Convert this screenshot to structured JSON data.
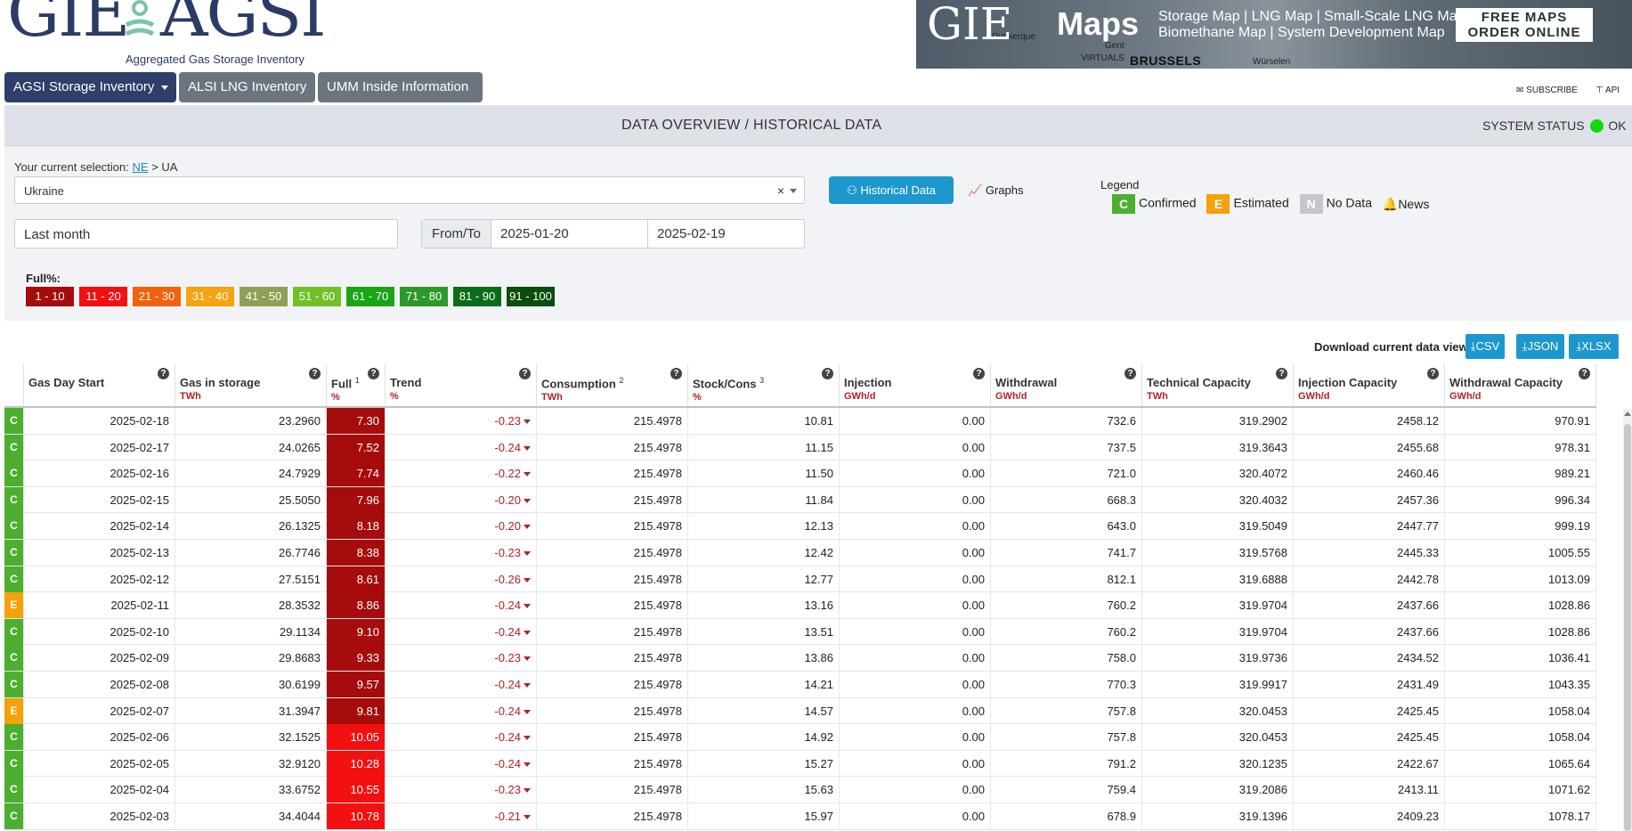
{
  "header": {
    "logo_gie": "GIE",
    "logo_agsi": "AGSI",
    "logo_subtitle": "Aggregated Gas Storage Inventory",
    "banner": {
      "brand": "GIE",
      "maps": "Maps",
      "line1": "Storage Map | LNG Map | Small-Scale LNG Map",
      "line2": "Biomethane Map | System Development Map",
      "cta_line1": "FREE MAPS",
      "cta_line2": "ORDER ONLINE",
      "city": "BRUSSELS",
      "place1": "VIRTUALS",
      "place2": "Dunkerque",
      "place3": "Gent",
      "place4": "Würselen"
    },
    "nav": {
      "primary": "AGSI Storage Inventory",
      "second": "ALSI LNG Inventory",
      "third": "UMM Inside Information"
    },
    "subscribe": "SUBSCRIBE",
    "api": "API"
  },
  "panel": {
    "title": "DATA OVERVIEW / HISTORICAL DATA",
    "system_status_label": "SYSTEM STATUS",
    "system_status_value": "OK",
    "status_color": "#12d80f",
    "selection_prefix": "Your current selection:",
    "selection_link": "NE",
    "selection_rest": "> UA",
    "country": "Ukraine",
    "clear_glyph": "×",
    "historical_button": "Historical Data",
    "graphs_button": "Graphs",
    "legend_title": "Legend",
    "legend": [
      {
        "badge": "C",
        "label": "Confirmed",
        "color": "#4caf30"
      },
      {
        "badge": "E",
        "label": "Estimated",
        "color": "#f5a10a"
      },
      {
        "badge": "N",
        "label": "No Data",
        "color": "#c3c6ca"
      }
    ],
    "news": "News",
    "period": "Last month",
    "from_to_label": "From/To",
    "from_date": "2025-01-20",
    "to_date": "2025-02-19",
    "full_label": "Full%:",
    "scale": [
      {
        "label": "1 - 10",
        "color": "#a60c0c"
      },
      {
        "label": "11 - 20",
        "color": "#f21010"
      },
      {
        "label": "21 - 30",
        "color": "#f2620e"
      },
      {
        "label": "31 - 40",
        "color": "#f5a30f"
      },
      {
        "label": "41 - 50",
        "color": "#8ea055"
      },
      {
        "label": "51 - 60",
        "color": "#71c124"
      },
      {
        "label": "61 - 70",
        "color": "#1aa516"
      },
      {
        "label": "71 - 80",
        "color": "#2c9a2a"
      },
      {
        "label": "81 - 90",
        "color": "#0c6d18"
      },
      {
        "label": "91 - 100",
        "color": "#0a4d0c"
      }
    ]
  },
  "downloads": {
    "label": "Download current data view:",
    "csv": "CSV",
    "json": "JSON",
    "xlsx": "XLSX"
  },
  "table": {
    "columns": [
      {
        "name": "Gas Day Start",
        "sup": "",
        "unit": ""
      },
      {
        "name": "Gas in storage",
        "sup": "",
        "unit": "TWh"
      },
      {
        "name": "Full",
        "sup": "1",
        "unit": "%"
      },
      {
        "name": "Trend",
        "sup": "",
        "unit": "%"
      },
      {
        "name": "Consumption",
        "sup": "2",
        "unit": "TWh"
      },
      {
        "name": "Stock/Cons",
        "sup": "3",
        "unit": "%"
      },
      {
        "name": "Injection",
        "sup": "",
        "unit": "GWh/d"
      },
      {
        "name": "Withdrawal",
        "sup": "",
        "unit": "GWh/d"
      },
      {
        "name": "Technical Capacity",
        "sup": "",
        "unit": "TWh"
      },
      {
        "name": "Injection Capacity",
        "sup": "",
        "unit": "GWh/d"
      },
      {
        "name": "Withdrawal Capacity",
        "sup": "",
        "unit": "GWh/d"
      }
    ],
    "rows": [
      {
        "status": "C",
        "date": "2025-02-18",
        "gas": "23.2960",
        "full": "7.30",
        "trend": "-0.23",
        "cons": "215.4978",
        "stock": "10.81",
        "inj": "0.00",
        "wd": "732.6",
        "tech": "319.2902",
        "injcap": "2458.12",
        "wdcap": "970.91"
      },
      {
        "status": "C",
        "date": "2025-02-17",
        "gas": "24.0265",
        "full": "7.52",
        "trend": "-0.24",
        "cons": "215.4978",
        "stock": "11.15",
        "inj": "0.00",
        "wd": "737.5",
        "tech": "319.3643",
        "injcap": "2455.68",
        "wdcap": "978.31"
      },
      {
        "status": "C",
        "date": "2025-02-16",
        "gas": "24.7929",
        "full": "7.74",
        "trend": "-0.22",
        "cons": "215.4978",
        "stock": "11.50",
        "inj": "0.00",
        "wd": "721.0",
        "tech": "320.4072",
        "injcap": "2460.46",
        "wdcap": "989.21"
      },
      {
        "status": "C",
        "date": "2025-02-15",
        "gas": "25.5050",
        "full": "7.96",
        "trend": "-0.20",
        "cons": "215.4978",
        "stock": "11.84",
        "inj": "0.00",
        "wd": "668.3",
        "tech": "320.4032",
        "injcap": "2457.36",
        "wdcap": "996.34"
      },
      {
        "status": "C",
        "date": "2025-02-14",
        "gas": "26.1325",
        "full": "8.18",
        "trend": "-0.20",
        "cons": "215.4978",
        "stock": "12.13",
        "inj": "0.00",
        "wd": "643.0",
        "tech": "319.5049",
        "injcap": "2447.77",
        "wdcap": "999.19"
      },
      {
        "status": "C",
        "date": "2025-02-13",
        "gas": "26.7746",
        "full": "8.38",
        "trend": "-0.23",
        "cons": "215.4978",
        "stock": "12.42",
        "inj": "0.00",
        "wd": "741.7",
        "tech": "319.5768",
        "injcap": "2445.33",
        "wdcap": "1005.55"
      },
      {
        "status": "C",
        "date": "2025-02-12",
        "gas": "27.5151",
        "full": "8.61",
        "trend": "-0.26",
        "cons": "215.4978",
        "stock": "12.77",
        "inj": "0.00",
        "wd": "812.1",
        "tech": "319.6888",
        "injcap": "2442.78",
        "wdcap": "1013.09"
      },
      {
        "status": "E",
        "date": "2025-02-11",
        "gas": "28.3532",
        "full": "8.86",
        "trend": "-0.24",
        "cons": "215.4978",
        "stock": "13.16",
        "inj": "0.00",
        "wd": "760.2",
        "tech": "319.9704",
        "injcap": "2437.66",
        "wdcap": "1028.86"
      },
      {
        "status": "C",
        "date": "2025-02-10",
        "gas": "29.1134",
        "full": "9.10",
        "trend": "-0.24",
        "cons": "215.4978",
        "stock": "13.51",
        "inj": "0.00",
        "wd": "760.2",
        "tech": "319.9704",
        "injcap": "2437.66",
        "wdcap": "1028.86"
      },
      {
        "status": "C",
        "date": "2025-02-09",
        "gas": "29.8683",
        "full": "9.33",
        "trend": "-0.23",
        "cons": "215.4978",
        "stock": "13.86",
        "inj": "0.00",
        "wd": "758.0",
        "tech": "319.9736",
        "injcap": "2434.52",
        "wdcap": "1036.41"
      },
      {
        "status": "C",
        "date": "2025-02-08",
        "gas": "30.6199",
        "full": "9.57",
        "trend": "-0.24",
        "cons": "215.4978",
        "stock": "14.21",
        "inj": "0.00",
        "wd": "770.3",
        "tech": "319.9917",
        "injcap": "2431.49",
        "wdcap": "1043.35"
      },
      {
        "status": "E",
        "date": "2025-02-07",
        "gas": "31.3947",
        "full": "9.81",
        "trend": "-0.24",
        "cons": "215.4978",
        "stock": "14.57",
        "inj": "0.00",
        "wd": "757.8",
        "tech": "320.0453",
        "injcap": "2425.45",
        "wdcap": "1058.04"
      },
      {
        "status": "C",
        "date": "2025-02-06",
        "gas": "32.1525",
        "full": "10.05",
        "trend": "-0.24",
        "cons": "215.4978",
        "stock": "14.92",
        "inj": "0.00",
        "wd": "757.8",
        "tech": "320.0453",
        "injcap": "2425.45",
        "wdcap": "1058.04"
      },
      {
        "status": "C",
        "date": "2025-02-05",
        "gas": "32.9120",
        "full": "10.28",
        "trend": "-0.24",
        "cons": "215.4978",
        "stock": "15.27",
        "inj": "0.00",
        "wd": "791.2",
        "tech": "320.1235",
        "injcap": "2422.67",
        "wdcap": "1065.64"
      },
      {
        "status": "C",
        "date": "2025-02-04",
        "gas": "33.6752",
        "full": "10.55",
        "trend": "-0.23",
        "cons": "215.4978",
        "stock": "15.63",
        "inj": "0.00",
        "wd": "759.4",
        "tech": "319.2086",
        "injcap": "2413.11",
        "wdcap": "1071.62"
      },
      {
        "status": "C",
        "date": "2025-02-03",
        "gas": "34.4044",
        "full": "10.78",
        "trend": "-0.21",
        "cons": "215.4978",
        "stock": "15.97",
        "inj": "0.00",
        "wd": "678.9",
        "tech": "319.1396",
        "injcap": "2409.23",
        "wdcap": "1078.17"
      }
    ]
  }
}
